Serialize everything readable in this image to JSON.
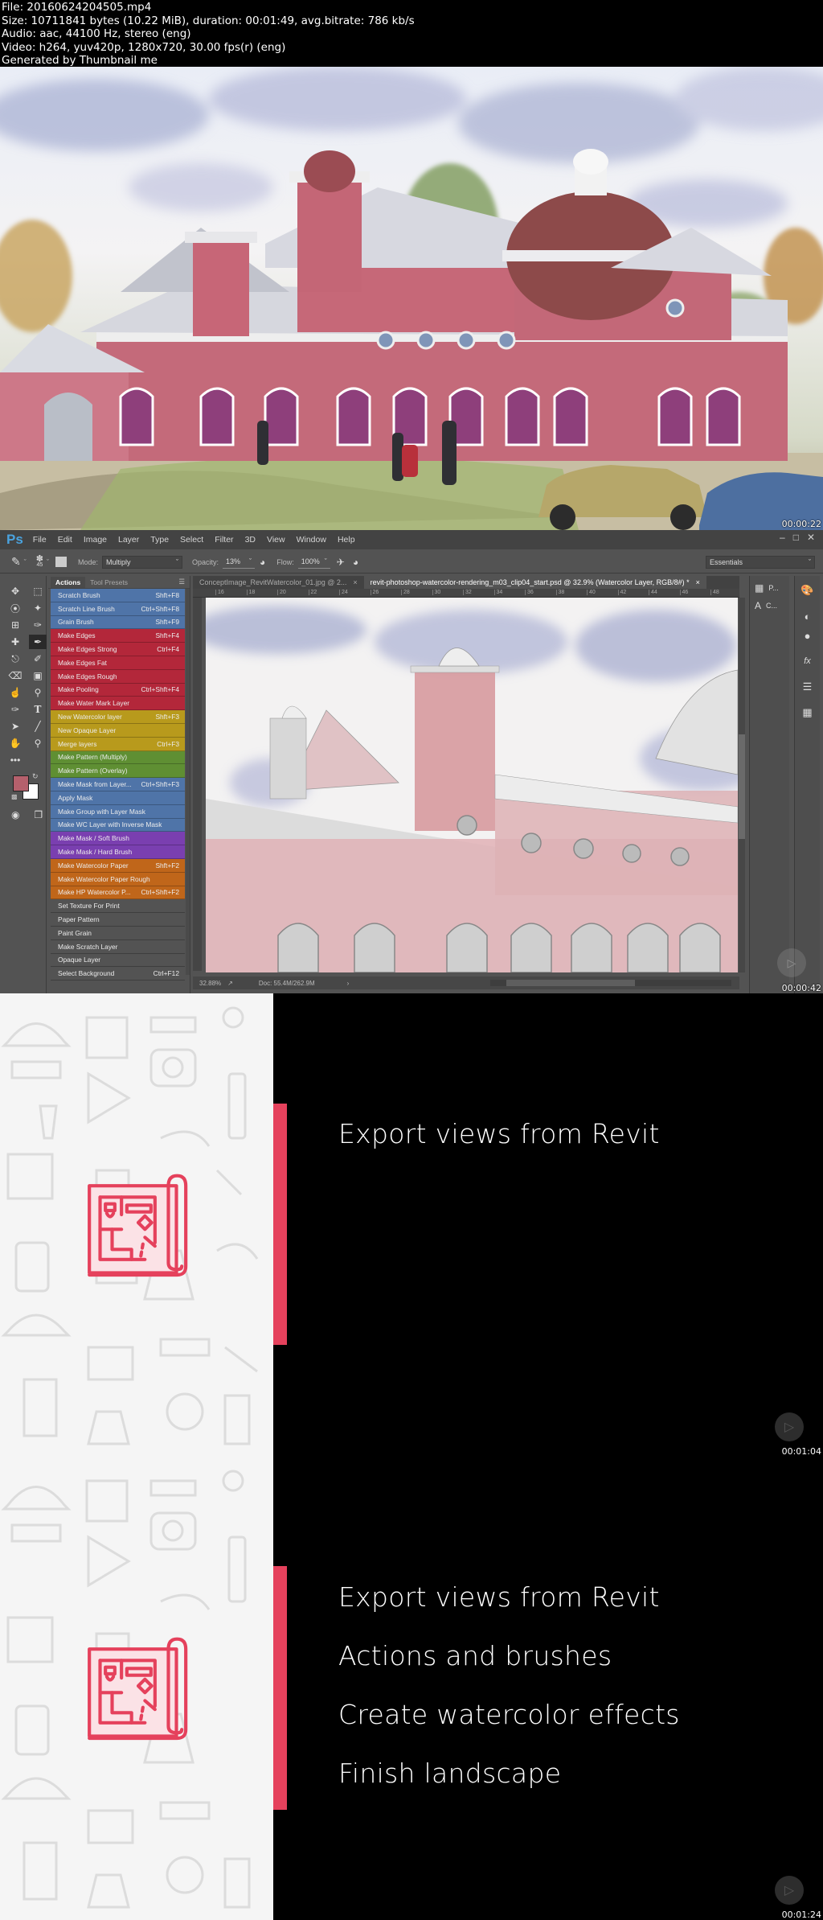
{
  "file_info": {
    "lines": [
      "File: 20160624204505.mp4",
      "Size: 10711841 bytes (10.22 MiB), duration: 00:01:49, avg.bitrate: 786 kb/s",
      "Audio: aac, 44100 Hz, stereo (eng)",
      "Video: h264, yuv420p, 1280x720, 30.00 fps(r) (eng)",
      "Generated by Thumbnail me"
    ]
  },
  "frames": [
    {
      "timestamp": "00:00:22",
      "description": "Watercolor rendering of brick building with domes"
    },
    {
      "timestamp": "00:00:42"
    },
    {
      "timestamp": "00:01:04"
    },
    {
      "timestamp": "00:01:24"
    }
  ],
  "photoshop": {
    "logo": "Ps",
    "menu": [
      "File",
      "Edit",
      "Image",
      "Layer",
      "Type",
      "Select",
      "Filter",
      "3D",
      "View",
      "Window",
      "Help"
    ],
    "window_controls": [
      "minimize",
      "maximize",
      "close"
    ],
    "options_bar": {
      "brush_size": "45",
      "mode_label": "Mode:",
      "mode_value": "Multiply",
      "opacity_label": "Opacity:",
      "opacity_value": "13%",
      "flow_label": "Flow:",
      "flow_value": "100%",
      "workspace": "Essentials"
    },
    "panel_tabs": [
      "Actions",
      "Tool Presets"
    ],
    "actions": [
      {
        "label": "Scratch Brush",
        "shortcut": "Shft+F8",
        "color": "#4f74a8"
      },
      {
        "label": "Scratch Line Brush",
        "shortcut": "Ctrl+Shft+F8",
        "color": "#4f74a8"
      },
      {
        "label": "Grain Brush",
        "shortcut": "Shft+F9",
        "color": "#4f74a8"
      },
      {
        "label": "Make Edges",
        "shortcut": "Shft+F4",
        "color": "#b3273a"
      },
      {
        "label": "Make Edges Strong",
        "shortcut": "Ctrl+F4",
        "color": "#b3273a"
      },
      {
        "label": "Make Edges Fat",
        "shortcut": "",
        "color": "#b3273a"
      },
      {
        "label": "Make Edges Rough",
        "shortcut": "",
        "color": "#b3273a"
      },
      {
        "label": "Make Pooling",
        "shortcut": "Ctrl+Shft+F4",
        "color": "#b3273a"
      },
      {
        "label": "Make Water Mark Layer",
        "shortcut": "",
        "color": "#b3273a"
      },
      {
        "label": "New Watercolor layer",
        "shortcut": "Shft+F3",
        "color": "#b89a1c"
      },
      {
        "label": "New Opaque Layer",
        "shortcut": "",
        "color": "#b89a1c"
      },
      {
        "label": "Merge layers",
        "shortcut": "Ctrl+F3",
        "color": "#b89a1c"
      },
      {
        "label": "Make Pattern (Multiply)",
        "shortcut": "",
        "color": "#5f8f33"
      },
      {
        "label": "Make Pattern (Overlay)",
        "shortcut": "",
        "color": "#5f8f33"
      },
      {
        "label": "Make Mask from Layer...",
        "shortcut": "Ctrl+Shft+F3",
        "color": "#4f74a8"
      },
      {
        "label": "Apply Mask",
        "shortcut": "",
        "color": "#4f74a8"
      },
      {
        "label": "Make Group with Layer Mask",
        "shortcut": "",
        "color": "#4f74a8"
      },
      {
        "label": "Make WC Layer with Inverse Mask",
        "shortcut": "",
        "color": "#4f74a8"
      },
      {
        "label": "Make Mask / Soft Brush",
        "shortcut": "",
        "color": "#7a3fb0"
      },
      {
        "label": "Make Mask / Hard Brush",
        "shortcut": "",
        "color": "#7a3fb0"
      },
      {
        "label": "Make Watercolor Paper",
        "shortcut": "Shft+F2",
        "color": "#c0661a"
      },
      {
        "label": "Make Watercolor Paper Rough",
        "shortcut": "",
        "color": "#c0661a"
      },
      {
        "label": "Make HP Watercolor P...",
        "shortcut": "Ctrl+Shft+F2",
        "color": "#c0661a"
      },
      {
        "label": "Set Texture For Print",
        "shortcut": "",
        "color": "#535353"
      },
      {
        "label": "Paper Pattern",
        "shortcut": "",
        "color": "#535353"
      },
      {
        "label": "Paint Grain",
        "shortcut": "",
        "color": "#535353"
      },
      {
        "label": "Make Scratch Layer",
        "shortcut": "",
        "color": "#535353"
      },
      {
        "label": "Opaque Layer",
        "shortcut": "",
        "color": "#535353"
      },
      {
        "label": "Select Background",
        "shortcut": "Ctrl+F12",
        "color": "#535353"
      }
    ],
    "doc_tabs": [
      {
        "label": "ConceptImage_RevitWatercolor_01.jpg @ 2...",
        "active": false
      },
      {
        "label": "revit-photoshop-watercolor-rendering_m03_clip04_start.psd @ 32.9% (Watercolor Layer, RGB/8#) *",
        "active": true
      }
    ],
    "ruler_ticks": [
      "16",
      "18",
      "20",
      "22",
      "24",
      "26",
      "28",
      "30",
      "32",
      "34",
      "36",
      "38",
      "40",
      "42",
      "44",
      "46",
      "48"
    ],
    "status": {
      "zoom": "32.88%",
      "doc": "Doc: 55.4M/262.9M"
    },
    "dock_labels": [
      "P...",
      "C..."
    ],
    "foreground_color": "#b5606c",
    "background_color": "#ffffff"
  },
  "slides": [
    {
      "items": [
        "Export views from Revit"
      ]
    },
    {
      "items": [
        "Export views from Revit",
        "Actions and brushes",
        "Create watercolor effects",
        "Finish landscape"
      ]
    }
  ],
  "accent_color": "#e5415c"
}
